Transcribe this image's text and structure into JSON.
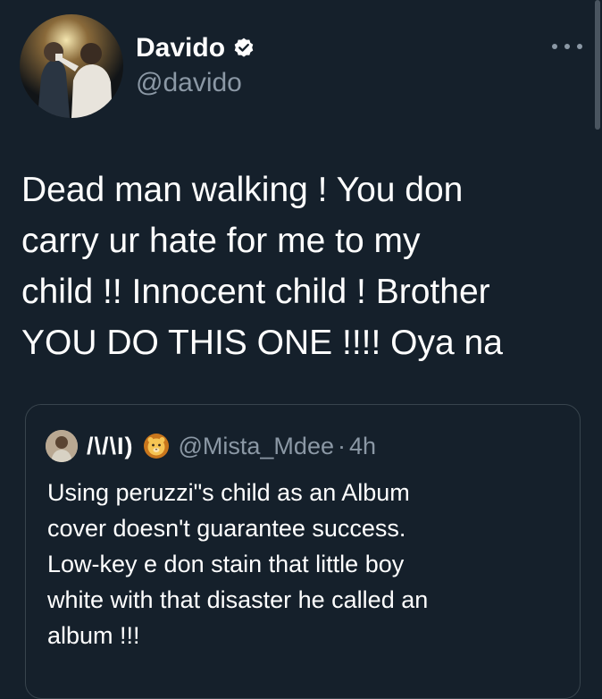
{
  "author": {
    "name": "Davido",
    "handle": "@davido",
    "verified": true
  },
  "tweet": {
    "text": "Dead man walking ! You don\ncarry ur hate for me to my\nchild !! Innocent child ! Brother\nYOU DO THIS ONE !!!! Oya na"
  },
  "quoted_tweet": {
    "display_name": "/\\/\\I)",
    "handle": "@Mista_Mdee",
    "separator": "·",
    "time": "4h",
    "text": "Using peruzzi\"s child as an Album\ncover doesn't guarantee success.\nLow-key e don stain that little boy\nwhite with that disaster he called an\nalbum !!!"
  },
  "icons": {
    "verified": "verified-badge-icon",
    "more": "more-options-icon",
    "emoji": "lion-emoji-icon"
  },
  "colors": {
    "background": "#15202b",
    "text": "#ffffff",
    "secondary_text": "#8b98a5",
    "border": "#38444d"
  }
}
